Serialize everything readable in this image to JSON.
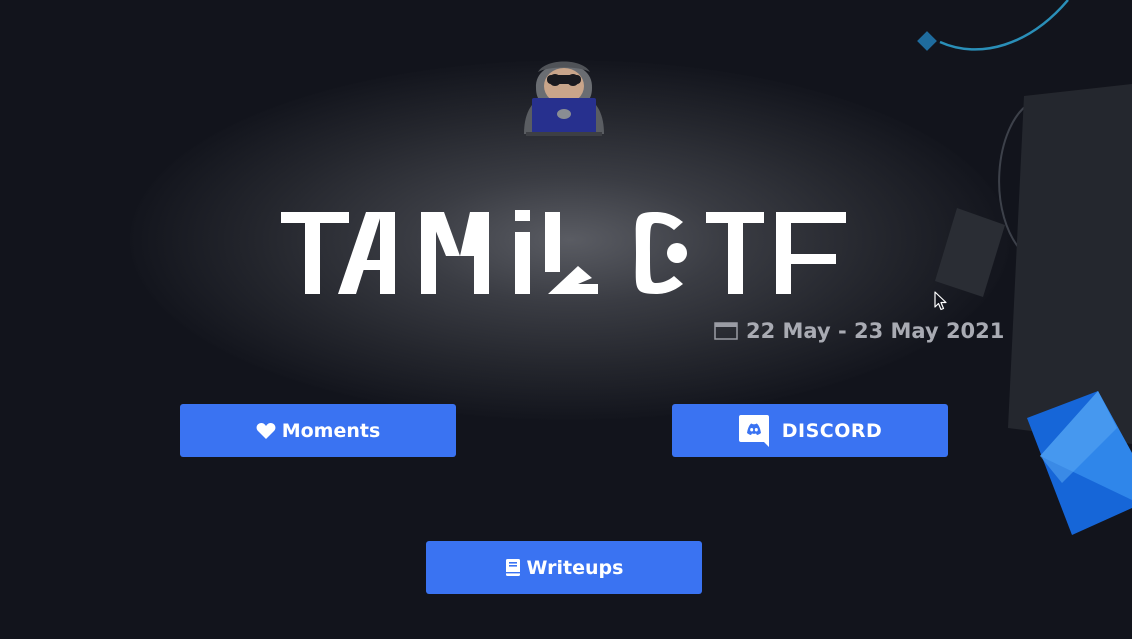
{
  "hero": {
    "title": "TAMIL CTF",
    "date": "22 May - 23 May 2021"
  },
  "buttons": {
    "moments": "Moments",
    "discord": "DISCORD",
    "writeups": "Writeups"
  },
  "icons": {
    "hacker": "hacker-mascot-icon",
    "calendar": "calendar-icon",
    "heart": "heart-icon",
    "discord": "discord-logo-icon",
    "book": "book-icon",
    "cursor": "mouse-cursor-icon"
  },
  "colors": {
    "background": "#12141c",
    "button": "#3a73f2",
    "date_text": "#a9abb3",
    "title_text": "#ffffff",
    "accent_blue": "#1d7be8"
  }
}
